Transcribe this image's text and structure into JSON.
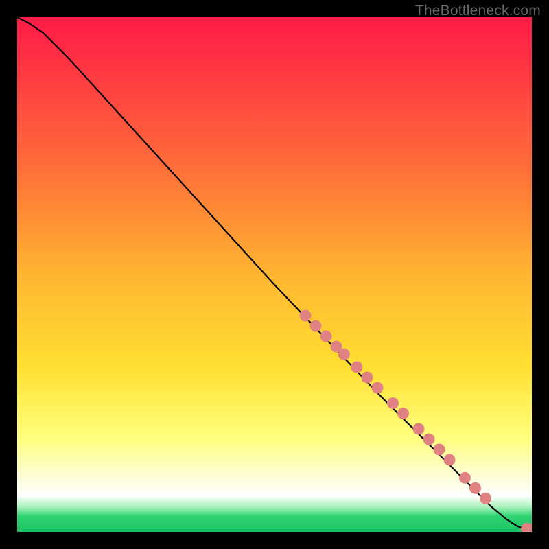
{
  "watermark": "TheBottleneck.com",
  "colors": {
    "page_bg": "#000000",
    "line": "#000000",
    "point_fill": "#e08282",
    "point_stroke": "#c86b6b",
    "grad_top": "#ff1a47",
    "grad_mid1": "#ff8a2a",
    "grad_mid2": "#ffe031",
    "grad_mid3": "#ffff80",
    "grad_mid4": "#fdfde0",
    "grad_green1": "#8fe8a2",
    "grad_green2": "#2ed573",
    "grad_green3": "#1fbf62"
  },
  "chart_data": {
    "type": "line",
    "title": "",
    "xlabel": "",
    "ylabel": "",
    "xlim": [
      0,
      100
    ],
    "ylim": [
      0,
      100
    ],
    "series": [
      {
        "name": "curve",
        "x": [
          0,
          2,
          5,
          10,
          20,
          30,
          40,
          50,
          60,
          70,
          80,
          88,
          92,
          95,
          97,
          98.5,
          100
        ],
        "y": [
          100,
          99,
          97,
          92,
          81,
          70,
          59,
          48,
          37.5,
          27,
          17,
          9,
          5,
          2.5,
          1.2,
          0.6,
          0.5
        ]
      }
    ],
    "points": [
      {
        "x": 56,
        "y": 42
      },
      {
        "x": 58,
        "y": 40
      },
      {
        "x": 60,
        "y": 38
      },
      {
        "x": 62,
        "y": 36
      },
      {
        "x": 63.5,
        "y": 34.5
      },
      {
        "x": 66,
        "y": 32
      },
      {
        "x": 68,
        "y": 30
      },
      {
        "x": 70,
        "y": 28
      },
      {
        "x": 73,
        "y": 25
      },
      {
        "x": 75,
        "y": 23
      },
      {
        "x": 78,
        "y": 20
      },
      {
        "x": 80,
        "y": 18
      },
      {
        "x": 82,
        "y": 16
      },
      {
        "x": 84,
        "y": 14
      },
      {
        "x": 87,
        "y": 10.5
      },
      {
        "x": 89,
        "y": 8.5
      },
      {
        "x": 91,
        "y": 6.5
      },
      {
        "x": 99,
        "y": 0.6
      },
      {
        "x": 100,
        "y": 0.5
      }
    ],
    "point_radius": 8.5
  }
}
